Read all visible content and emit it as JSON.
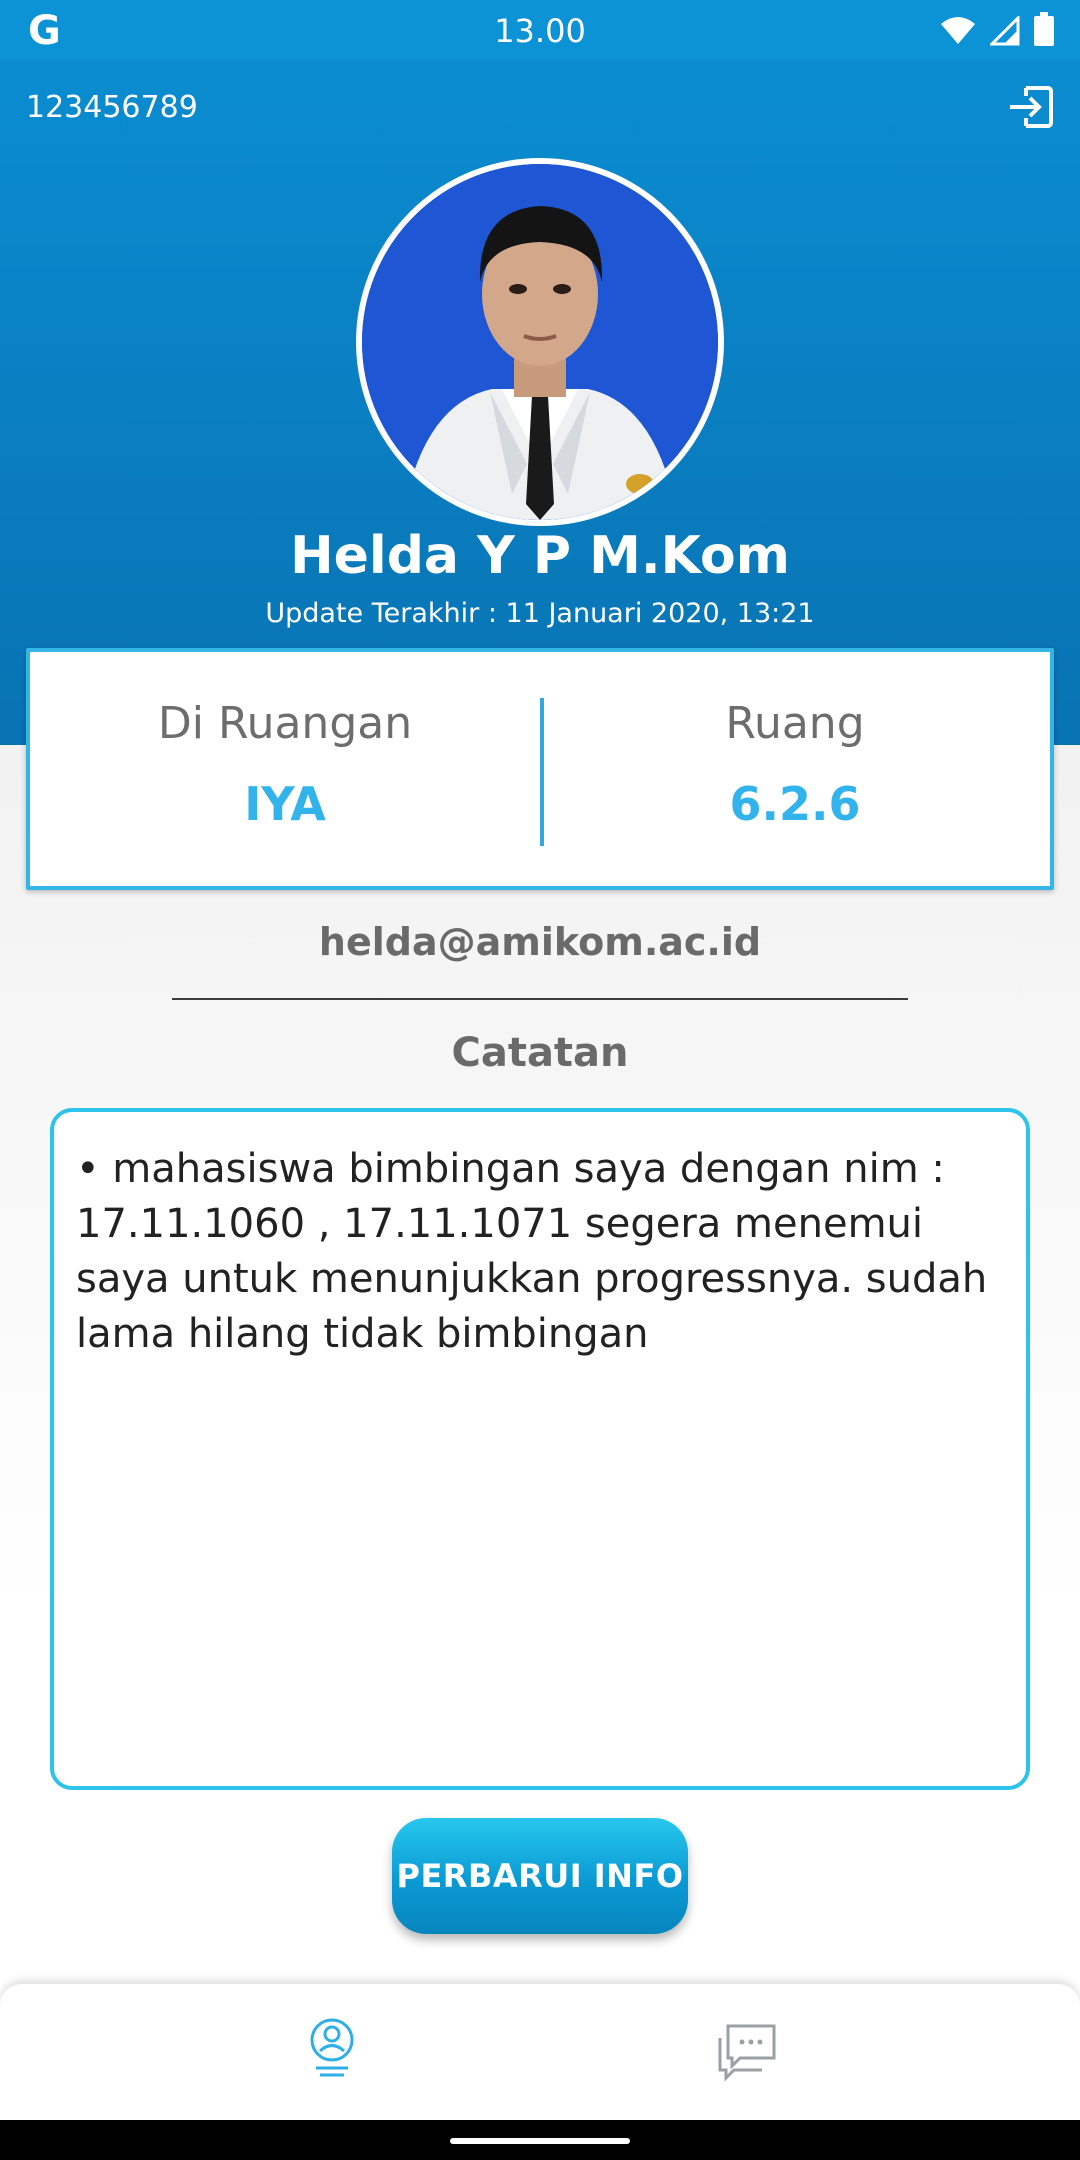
{
  "status_bar": {
    "g_label": "G",
    "time": "13.00"
  },
  "header": {
    "user_id": "123456789",
    "name": "Helda Y P M.Kom",
    "last_update": "Update Terakhir : 11 Januari 2020, 13:21"
  },
  "info_card": {
    "in_room_label": "Di Ruangan",
    "in_room_value": "IYA",
    "room_label": "Ruang",
    "room_value": "6.2.6"
  },
  "email": "helda@amikom.ac.id",
  "notes": {
    "title": "Catatan",
    "text": "• mahasiswa bimbingan saya dengan nim : 17.11.1060 , 17.11.1071 segera menemui saya untuk menunjukkan progressnya. sudah lama hilang tidak bimbingan"
  },
  "update_button": {
    "label": "PERBARUI INFO"
  },
  "bottom_nav": [
    {
      "icon": "profile-icon",
      "active": true
    },
    {
      "icon": "chat-icon",
      "active": false
    }
  ],
  "colors": {
    "header_blue": "#0a7fc2",
    "accent_cyan": "#2ec3ea",
    "value_blue": "#33b3ec"
  }
}
